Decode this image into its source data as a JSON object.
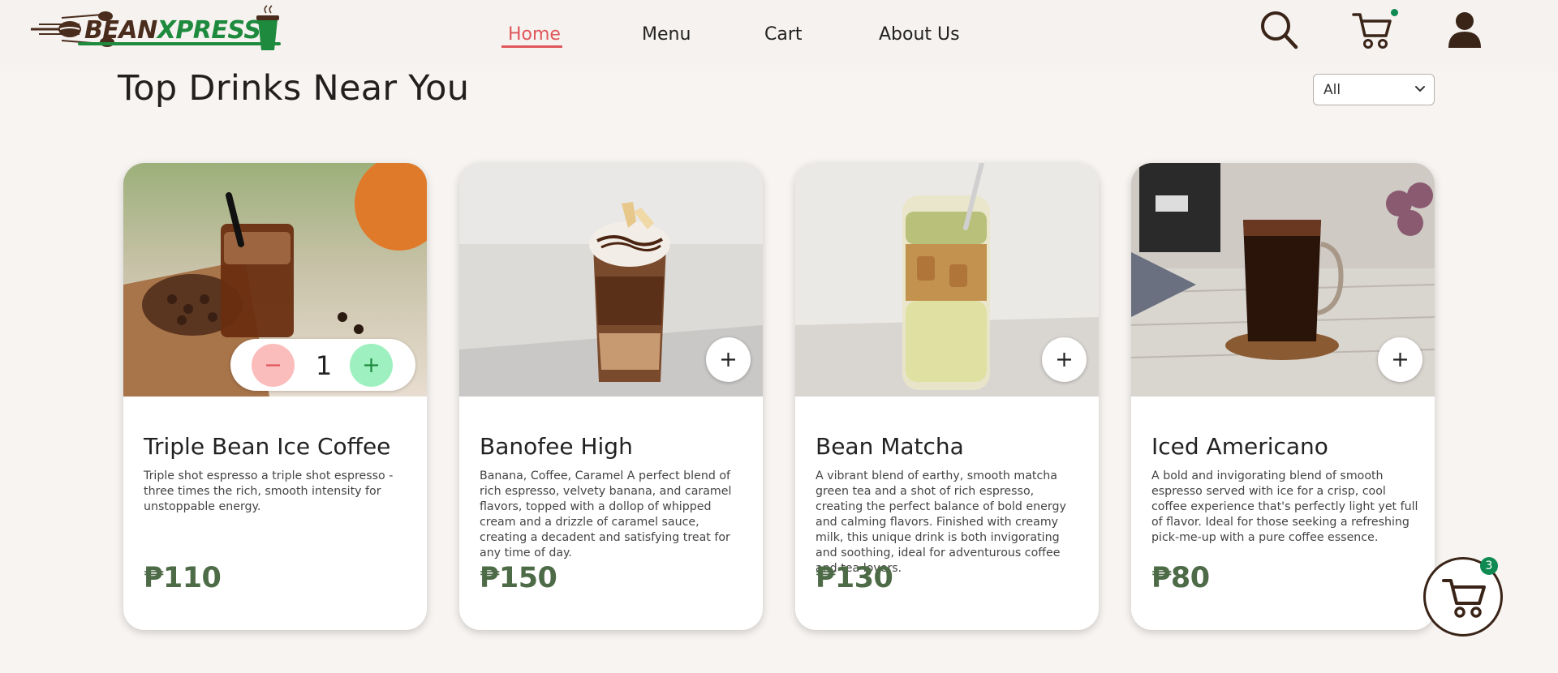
{
  "brand": {
    "part1": "BEAN",
    "part2": "XPRESS"
  },
  "nav": {
    "home": "Home",
    "menu": "Menu",
    "cart": "Cart",
    "about": "About Us"
  },
  "page": {
    "title": "Top Drinks Near You"
  },
  "filter": {
    "selected": "All"
  },
  "currency": "₱",
  "cards": [
    {
      "name": "Triple Bean Ice Coffee",
      "description": "Triple shot espresso a triple shot espresso - three times the rich, smooth intensity for unstoppable energy.",
      "price": "₱110",
      "quantity": "1"
    },
    {
      "name": "Banofee High",
      "description": "Banana, Coffee, Caramel A perfect blend of rich espresso, velvety banana, and caramel flavors, topped with a dollop of whipped cream and a drizzle of caramel sauce, creating a decadent and satisfying treat for any time of day.",
      "price": "₱150"
    },
    {
      "name": "Bean Matcha",
      "description": "A vibrant blend of earthy, smooth matcha green tea and a shot of rich espresso, creating the perfect balance of bold energy and calming flavors. Finished with creamy milk, this unique drink is both invigorating and soothing, ideal for adventurous coffee and tea lovers.",
      "price": "₱130"
    },
    {
      "name": "Iced Americano",
      "description": "A bold and invigorating blend of smooth espresso served with ice for a crisp, cool coffee experience that's perfectly light yet full of flavor. Ideal for those seeking a refreshing pick-me-up with a pure coffee essence.",
      "price": "₱80"
    }
  ],
  "floating_cart": {
    "count": "3"
  },
  "icons": [
    "search-icon",
    "cart-icon",
    "user-icon",
    "chevron-down-icon",
    "plus-icon",
    "minus-icon"
  ],
  "colors": {
    "accent_red": "#e0575b",
    "price_green": "#4e6b47",
    "brand_green": "#1e8a3e",
    "brand_brown": "#4a2c1d",
    "badge_green": "#0f8a52"
  }
}
